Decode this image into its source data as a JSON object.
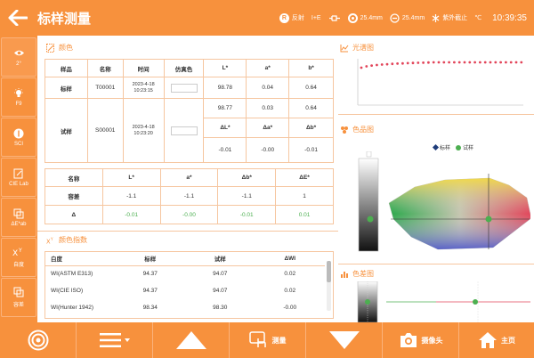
{
  "header": {
    "title": "标样测量",
    "mode_label": "R",
    "reflect_label": "反射",
    "ie_label": "I+E",
    "aperture1": "25.4mm",
    "aperture2": "25.4mm",
    "uv_label": "紫外截止",
    "temp_unit": "℃",
    "time": "10:39:35"
  },
  "sidebar": {
    "items": [
      {
        "label": "2°"
      },
      {
        "label": "F9"
      },
      {
        "label": "SCI"
      },
      {
        "label": "CIE Lab"
      },
      {
        "label": "ΔE*ab"
      },
      {
        "label": "自度"
      },
      {
        "label": "容差"
      }
    ]
  },
  "color_panel": {
    "title": "颜色",
    "headers": [
      "样品",
      "名称",
      "时间",
      "仿真色",
      "L*",
      "a*",
      "b*"
    ],
    "standard": {
      "label": "标样",
      "name": "T00001",
      "date": "2023-4-18",
      "time": "10:23:15",
      "L": "98.78",
      "a": "0.04",
      "b": "0.64"
    },
    "trial": {
      "label": "试样",
      "name": "S00001",
      "date": "2023-4-18",
      "time": "10:23:20",
      "L": "98.77",
      "a": "0.03",
      "b": "0.64"
    },
    "delta_headers": [
      "ΔL*",
      "Δa*",
      "Δb*"
    ],
    "delta_values": [
      "-0.01",
      "-0.00",
      "-0.01"
    ]
  },
  "tolerance_panel": {
    "headers": [
      "名称",
      "L*",
      "a*",
      "Δb*",
      "ΔE*"
    ],
    "tolerance_row": {
      "label": "容差",
      "values": [
        "-1.1",
        "-1.1",
        "-1.1",
        "1"
      ]
    },
    "delta_row": {
      "label": "Δ",
      "values": [
        "-0.01",
        "-0.00",
        "-0.01",
        "0.01"
      ]
    }
  },
  "index_panel": {
    "title": "颜色指数",
    "headers": [
      "白度",
      "标样",
      "试样",
      "ΔWI"
    ],
    "rows": [
      {
        "name": "WI(ASTM E313)",
        "std": "94.37",
        "trial": "94.07",
        "delta": "0.02"
      },
      {
        "name": "WI(CIE ISO)",
        "std": "94.37",
        "trial": "94.07",
        "delta": "0.02"
      },
      {
        "name": "WI(Hunter 1942)",
        "std": "98.34",
        "trial": "98.30",
        "delta": "-0.00"
      }
    ]
  },
  "spectrum_panel": {
    "title": "光谱图"
  },
  "gamut_panel": {
    "title": "色品图",
    "legend_std": "标样",
    "legend_trial": "试样"
  },
  "diff_panel": {
    "title": "色差图"
  },
  "bottombar": {
    "measure_label": "测量",
    "camera_label": "摄像头",
    "home_label": "主页"
  },
  "colors": {
    "accent": "#f7913d",
    "green": "#4caf50",
    "navy": "#1f3d7a"
  }
}
